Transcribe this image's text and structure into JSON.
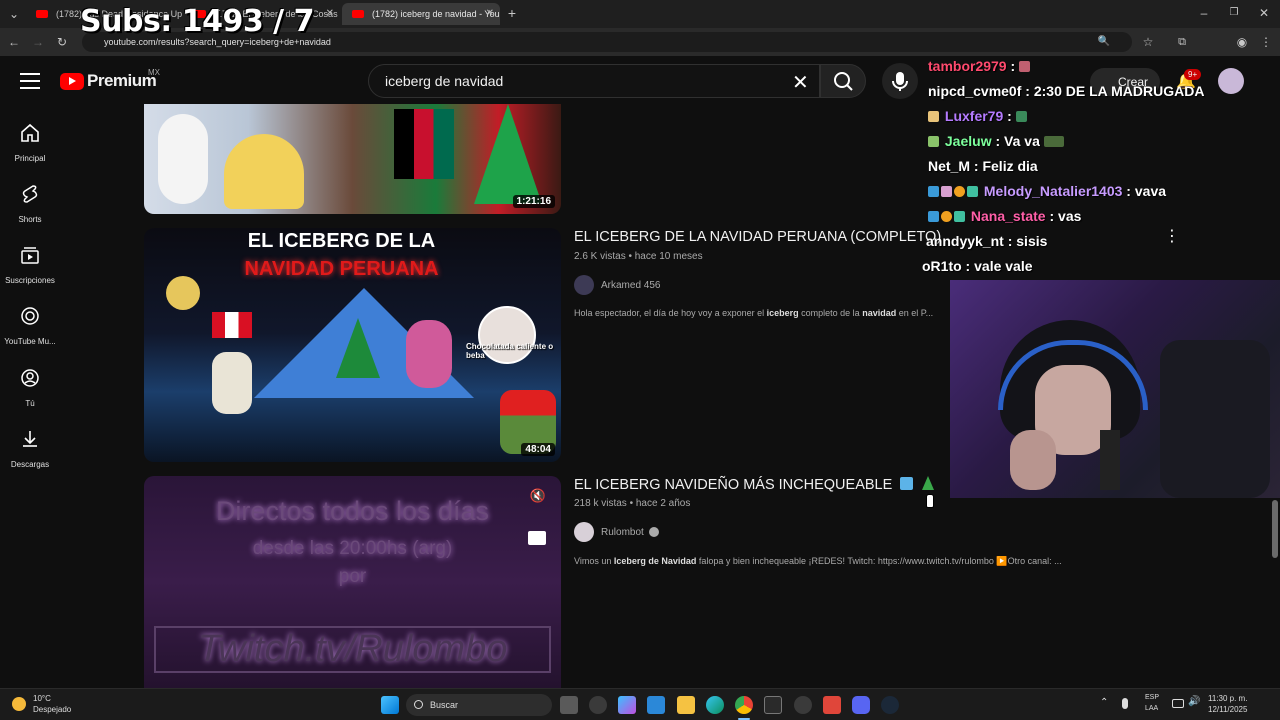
{
  "overlay": {
    "subs_text": "Subs: 1493 / 7"
  },
  "browser": {
    "tabs": [
      {
        "label": "(1782) Las Dead Residence Upon..."
      },
      {
        "label": "(1782) El Iceberg de las Cosas n..."
      },
      {
        "label": "(1782) iceberg de navidad - You..."
      }
    ],
    "url": "youtube.com/results?search_query=iceberg+de+navidad"
  },
  "youtube": {
    "logo_text": "Premium",
    "country": "MX",
    "search_value": "iceberg de navidad",
    "create_label": "Crear",
    "notif_count": "9+"
  },
  "sidebar": {
    "items": [
      {
        "label": "Principal",
        "icon": "home-icon"
      },
      {
        "label": "Shorts",
        "icon": "shorts-icon"
      },
      {
        "label": "Suscripciones",
        "icon": "subscriptions-icon"
      },
      {
        "label": "YouTube Mu...",
        "icon": "youtube-music-icon"
      },
      {
        "label": "Tú",
        "icon": "you-icon"
      },
      {
        "label": "Descargas",
        "icon": "download-icon"
      }
    ]
  },
  "results": [
    {
      "duration": "1:21:16"
    },
    {
      "title": "EL ICEBERG DE LA NAVIDAD PERUANA (COMPLETO)",
      "meta": "2.6 K vistas • hace 10 meses",
      "channel": "Arkamed 456",
      "desc_pre": "Hola espectador, el día de hoy voy a exponer el ",
      "desc_b1": "iceberg",
      "desc_mid": " completo de la ",
      "desc_b2": "navidad",
      "desc_post": " en el P...",
      "duration": "48:04",
      "thumb_line1": "EL ICEBERG DE LA",
      "thumb_line2": "NAVIDAD PERUANA",
      "thumb_caption": "Chocolatada caliente o beba"
    },
    {
      "title": "EL ICEBERG NAVIDEÑO MÁS INCHEQUEABLE",
      "meta": "218 k vistas • hace 2 años",
      "channel": "Rulombot",
      "desc_pre": "Vimos un ",
      "desc_b1": "Iceberg de Navidad",
      "desc_post": " falopa y bien inchequeable ¡REDES! Twitch: https://www.twitch.tv/rulombo ▶️Otro canal: ...",
      "thumb_line1": "Directos todos los días",
      "thumb_line2": "desde las 20:00hs (arg)",
      "thumb_line3": "por",
      "thumb_line4": "Twitch.tv/Rulombo"
    }
  ],
  "chat": [
    {
      "user": "tambor2979",
      "msg": "",
      "color": "#ff4a6e"
    },
    {
      "user": "nipcd_cvme0f",
      "msg": "2:30 DE LA MADRUGADA",
      "color": "#ffffff"
    },
    {
      "user": "Luxfer79",
      "msg": "",
      "color": "#b57bff"
    },
    {
      "user": "Jaeluw",
      "msg": "Va va",
      "color": "#7dff9c"
    },
    {
      "user": "Net_M",
      "msg": "Feliz dia",
      "color": "#ffffff"
    },
    {
      "user": "Melody_Natalier1403",
      "msg": "vava",
      "color": "#c79bff"
    },
    {
      "user": "Nana_state",
      "msg": "vas",
      "color": "#ff5fa8"
    },
    {
      "user": "anndyyk_nt",
      "msg": "sisis",
      "color": "#ffffff"
    },
    {
      "user": "oR1to",
      "msg": "vale vale",
      "color": "#ffffff"
    }
  ],
  "taskbar": {
    "temp": "10°C",
    "weather": "Despejado",
    "search_placeholder": "Buscar",
    "lang1": "ESP",
    "lang2": "LAA",
    "time": "11:30 p. m.",
    "date": "12/11/2025"
  }
}
